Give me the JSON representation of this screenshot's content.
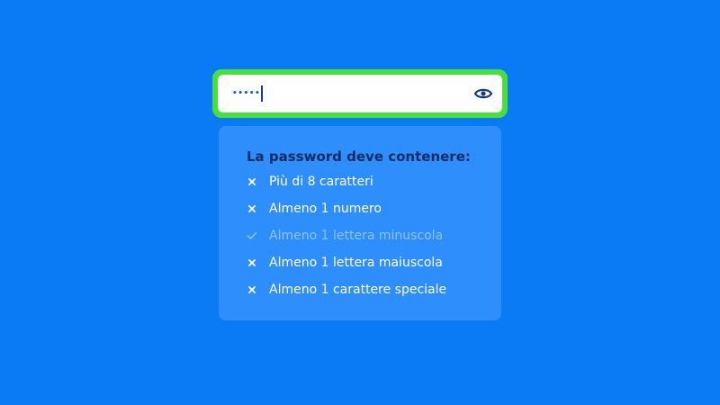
{
  "colors": {
    "background": "#0a7bf5",
    "panel_bg": "#2e8ffc",
    "focus_ring": "#4ade3c",
    "field_bg": "#ffffff",
    "title_text": "#0b2a66",
    "item_text": "#ffffff",
    "item_text_met": "#8ec2ff",
    "eye_icon": "#173a7d",
    "dots": "#1b57c9"
  },
  "password_field": {
    "value_masked": "•••••",
    "toggle_icon": "eye-icon"
  },
  "requirements": {
    "title": "La password deve contenere:",
    "items": [
      {
        "label": "Più di 8 caratteri",
        "met": false,
        "icon": "x-icon"
      },
      {
        "label": "Almeno 1 numero",
        "met": false,
        "icon": "x-icon"
      },
      {
        "label": "Almeno 1 lettera minuscola",
        "met": true,
        "icon": "check-icon"
      },
      {
        "label": "Almeno 1 lettera maiuscola",
        "met": false,
        "icon": "x-icon"
      },
      {
        "label": "Almeno 1 carattere speciale",
        "met": false,
        "icon": "x-icon"
      }
    ]
  }
}
